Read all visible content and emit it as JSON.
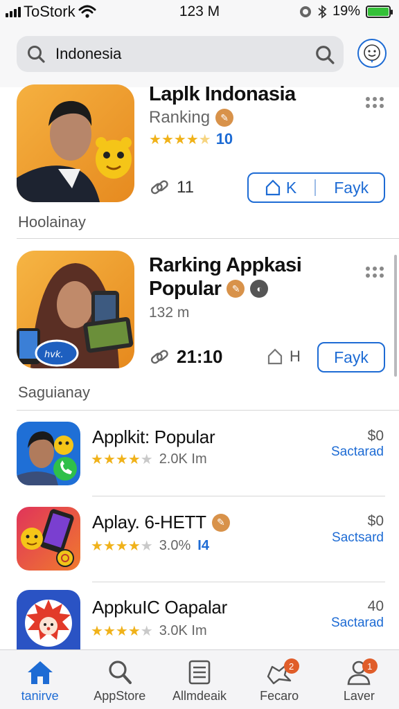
{
  "status_bar": {
    "carrier": "ToStork",
    "time": "123 M",
    "battery_percent": "19%"
  },
  "search": {
    "value": "Indonesia",
    "placeholder": ""
  },
  "featured": [
    {
      "title": "Laplk Indonasia",
      "subtitle": "Ranking",
      "rating": 4.5,
      "rating_label": "10",
      "meta_value": "11",
      "button_left": "K",
      "button_right": "Fayk"
    },
    {
      "title_line1": "Rarking Appkasi",
      "title_line2": "Popular",
      "subtitle": "132 m",
      "meta_value": "21:10",
      "bookmark_label": "H",
      "button_label": "Fayk"
    }
  ],
  "section_labels": {
    "first": "Hoolainay",
    "second": "Saguianay"
  },
  "list": [
    {
      "title": "Applkit: Popular",
      "rating": 4,
      "meta": "2.0K Im",
      "price": "$0",
      "link": "Sactarad"
    },
    {
      "title": "Aplay. 6-HETT",
      "rating": 4,
      "meta": "3.0%",
      "meta_accent": "I4",
      "price": "$0",
      "link": "Sactsard"
    },
    {
      "title": "AppkuIC Oapalar",
      "rating": 4,
      "meta": "3.0K Im",
      "price": "40",
      "link": "Sactarad"
    }
  ],
  "tabs": [
    {
      "label": "tanirve",
      "icon": "home-icon",
      "active": true
    },
    {
      "label": "AppStore",
      "icon": "search-icon",
      "active": false
    },
    {
      "label": "Allmdeaik",
      "icon": "list-icon",
      "active": false
    },
    {
      "label": "Fecaro",
      "icon": "megaphone-icon",
      "active": false,
      "badge": "2"
    },
    {
      "label": "Laver",
      "icon": "person-icon",
      "active": false,
      "badge": "1"
    }
  ],
  "colors": {
    "accent": "#1d6bd4",
    "star": "#f0b21a",
    "badge": "#e05d2a",
    "battery": "#34c038"
  }
}
